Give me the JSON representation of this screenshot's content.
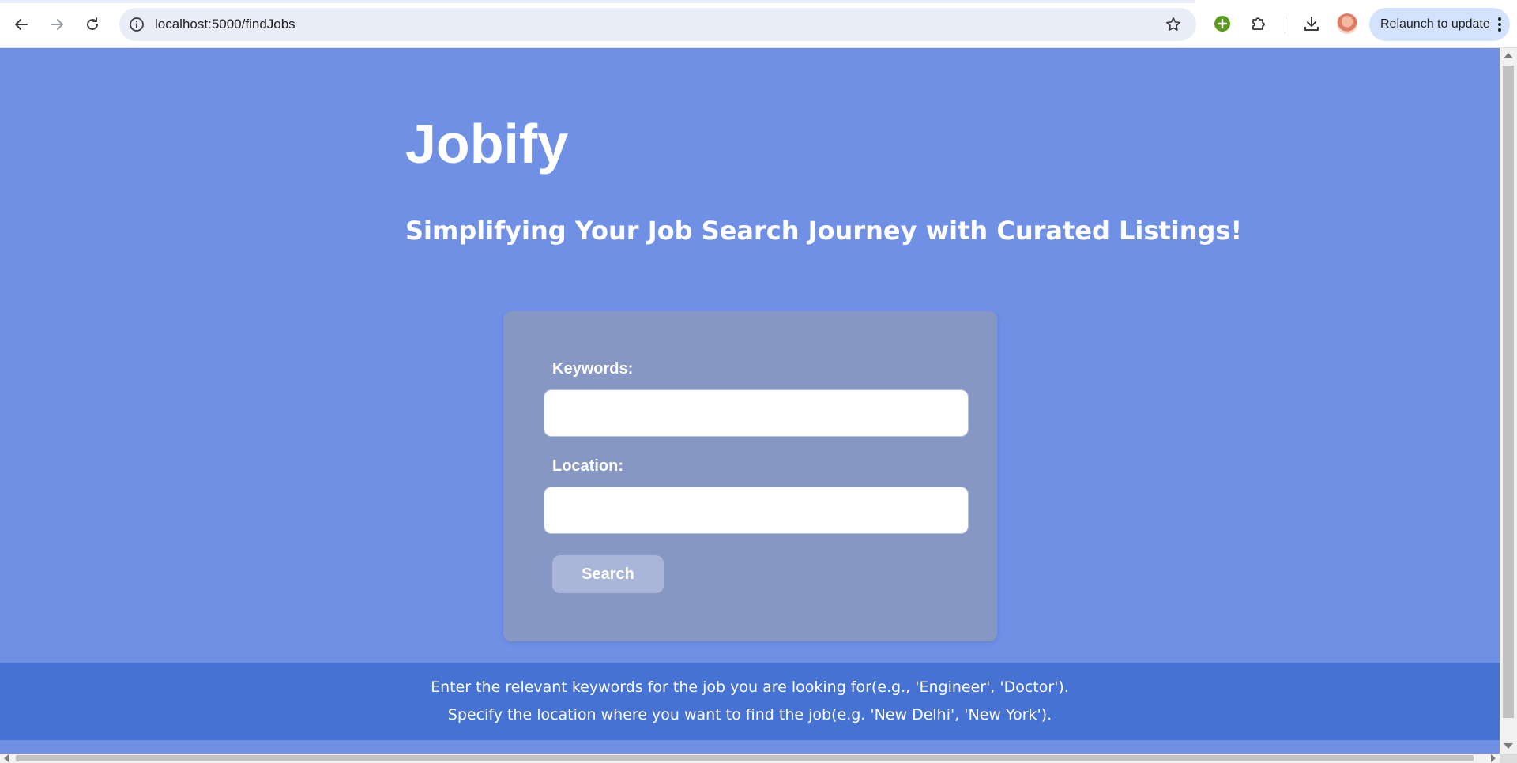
{
  "browser": {
    "url": "localhost:5000/findJobs",
    "relaunch_label": "Relaunch to update",
    "icons": {
      "back": "arrow-left-icon",
      "forward": "arrow-right-icon",
      "reload": "reload-icon",
      "site_info": "info-icon",
      "bookmark": "star-icon",
      "extension_add": "plus-circle-icon",
      "extensions": "puzzle-icon",
      "downloads": "download-icon",
      "menu": "kebab-menu-icon"
    }
  },
  "header": {
    "brand": "Jobify",
    "tagline": "Simplifying Your Job Search Journey with Curated Listings!"
  },
  "form": {
    "keywords_label": "Keywords:",
    "keywords_value": "",
    "location_label": "Location:",
    "location_value": "",
    "search_label": "Search"
  },
  "help": {
    "line1": "Enter the relevant keywords for the job you are looking for(e.g., 'Engineer', 'Doctor').",
    "line2": "Specify the location where you want to find the job(e.g. 'New Delhi', 'New York')."
  },
  "colors": {
    "page_bg": "#7090e6",
    "card_bg": "#8797c4",
    "button_bg": "#aab6d9",
    "help_band_bg": "#4673d3",
    "text": "#ffffff"
  }
}
